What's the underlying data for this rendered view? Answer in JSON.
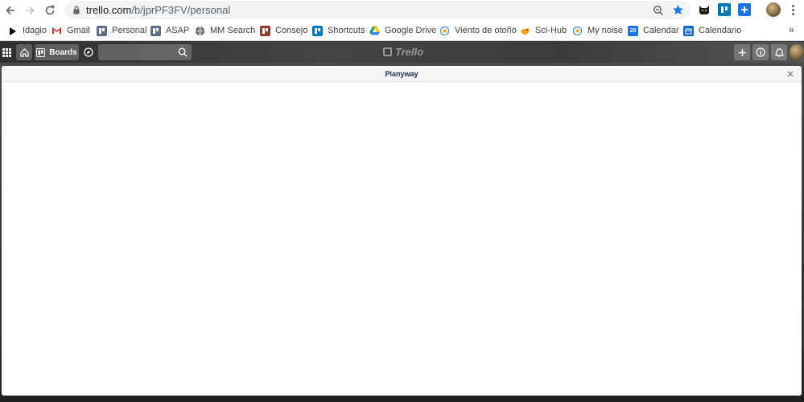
{
  "browser": {
    "url_host": "trello.com",
    "url_path": "/b/jprPF3FV/personal",
    "bookmarks": [
      {
        "label": "Idagio",
        "icon": "idagio-icon",
        "color": "#000000"
      },
      {
        "label": "Gmail",
        "icon": "gmail-icon",
        "color": "#d93025"
      },
      {
        "label": "Personal",
        "icon": "trello-board-icon",
        "color": "#5e6c84"
      },
      {
        "label": "ASAP",
        "icon": "trello-board-icon",
        "color": "#5e6c84"
      },
      {
        "label": "MM Search",
        "icon": "globe-icon",
        "color": "#5f6368"
      },
      {
        "label": "Consejo",
        "icon": "trello-board-icon",
        "color": "#8a3e2f"
      },
      {
        "label": "Shortcuts",
        "icon": "trello-icon",
        "color": "#0079bf"
      },
      {
        "label": "Google Drive",
        "icon": "google-drive-icon",
        "color": "#1fa463"
      },
      {
        "label": "Viento de otoño",
        "icon": "planet-icon",
        "color": "#4a90d9"
      },
      {
        "label": "Sci-Hub",
        "icon": "bird-icon",
        "color": "#f2a71b"
      },
      {
        "label": "My noise",
        "icon": "planet-icon",
        "color": "#4a90d9"
      },
      {
        "label": "Calendar",
        "icon": "calendar-icon",
        "color": "#1a73e8",
        "badge": "20"
      },
      {
        "label": "Calendario",
        "icon": "calendar-icon",
        "color": "#1565c0"
      }
    ],
    "more": "»"
  },
  "trello": {
    "boards_label": "Boards",
    "logo_text": "Trello"
  },
  "modal": {
    "title": "Planyway",
    "close": "×"
  }
}
